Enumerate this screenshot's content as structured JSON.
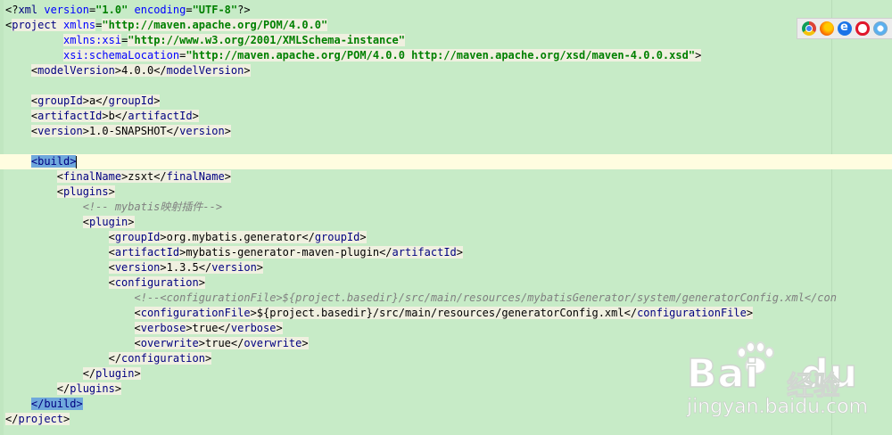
{
  "editor": {
    "lines": [
      {
        "segs": [
          [
            "bracket",
            "<?"
          ],
          [
            "tag",
            "xml "
          ],
          [
            "attr",
            "version"
          ],
          [
            "text",
            "="
          ],
          [
            "str",
            "\"1.0\""
          ],
          [
            "text",
            " "
          ],
          [
            "attr",
            "encoding"
          ],
          [
            "text",
            "="
          ],
          [
            "str",
            "\"UTF-8\""
          ],
          [
            "bracket",
            "?>"
          ]
        ]
      },
      {
        "segs": [
          [
            "bracket",
            "<"
          ],
          [
            "tag",
            "project "
          ],
          [
            "attr",
            "xmlns"
          ],
          [
            "text",
            "="
          ],
          [
            "str",
            "\"http://maven.apache.org/POM/4.0.0\""
          ]
        ]
      },
      {
        "segs": [
          [
            "text",
            "         "
          ],
          [
            "attr",
            "xmlns:xsi"
          ],
          [
            "text",
            "="
          ],
          [
            "str",
            "\"http://www.w3.org/2001/XMLSchema-instance\""
          ]
        ]
      },
      {
        "segs": [
          [
            "text",
            "         "
          ],
          [
            "attr",
            "xsi:schemaLocation"
          ],
          [
            "text",
            "="
          ],
          [
            "str",
            "\"http://maven.apache.org/POM/4.0.0 http://maven.apache.org/xsd/maven-4.0.0.xsd\""
          ],
          [
            "bracket",
            ">"
          ]
        ],
        "box": true
      },
      {
        "segs": [
          [
            "text",
            "    "
          ],
          [
            "bracket",
            "<"
          ],
          [
            "tag",
            "modelVersion"
          ],
          [
            "bracket",
            ">"
          ],
          [
            "text",
            "4.0.0"
          ],
          [
            "bracket",
            "</"
          ],
          [
            "tag",
            "modelVersion"
          ],
          [
            "bracket",
            ">"
          ]
        ]
      },
      {
        "segs": []
      },
      {
        "segs": [
          [
            "text",
            "    "
          ],
          [
            "bracket",
            "<"
          ],
          [
            "tag",
            "groupId"
          ],
          [
            "bracket",
            ">"
          ],
          [
            "text",
            "a"
          ],
          [
            "bracket",
            "</"
          ],
          [
            "tag",
            "groupId"
          ],
          [
            "bracket",
            ">"
          ]
        ]
      },
      {
        "segs": [
          [
            "text",
            "    "
          ],
          [
            "bracket",
            "<"
          ],
          [
            "tag",
            "artifactId"
          ],
          [
            "bracket",
            ">"
          ],
          [
            "text",
            "b"
          ],
          [
            "bracket",
            "</"
          ],
          [
            "tag",
            "artifactId"
          ],
          [
            "bracket",
            ">"
          ]
        ]
      },
      {
        "segs": [
          [
            "text",
            "    "
          ],
          [
            "bracket",
            "<"
          ],
          [
            "tag",
            "version"
          ],
          [
            "bracket",
            ">"
          ],
          [
            "text",
            "1.0-SNAPSHOT"
          ],
          [
            "bracket",
            "</"
          ],
          [
            "tag",
            "version"
          ],
          [
            "bracket",
            ">"
          ]
        ]
      },
      {
        "segs": []
      },
      {
        "segs": [
          [
            "text",
            "    "
          ],
          [
            "hl",
            "<build>"
          ],
          [
            "caret",
            ""
          ]
        ],
        "current": true
      },
      {
        "segs": [
          [
            "text",
            "        "
          ],
          [
            "bracket",
            "<"
          ],
          [
            "tag",
            "finalName"
          ],
          [
            "bracket",
            ">"
          ],
          [
            "text",
            "zsxt"
          ],
          [
            "bracket",
            "</"
          ],
          [
            "tag",
            "finalName"
          ],
          [
            "bracket",
            ">"
          ]
        ]
      },
      {
        "segs": [
          [
            "text",
            "        "
          ],
          [
            "bracket",
            "<"
          ],
          [
            "tag",
            "plugins"
          ],
          [
            "bracket",
            ">"
          ]
        ]
      },
      {
        "segs": [
          [
            "text",
            "            "
          ],
          [
            "comment",
            "<!-- mybatis映射插件-->"
          ]
        ]
      },
      {
        "segs": [
          [
            "text",
            "            "
          ],
          [
            "bracket",
            "<"
          ],
          [
            "tag",
            "plugin"
          ],
          [
            "bracket",
            ">"
          ]
        ]
      },
      {
        "segs": [
          [
            "text",
            "                "
          ],
          [
            "bracket",
            "<"
          ],
          [
            "tag",
            "groupId"
          ],
          [
            "bracket",
            ">"
          ],
          [
            "text",
            "org.mybatis.generator"
          ],
          [
            "bracket",
            "</"
          ],
          [
            "tag",
            "groupId"
          ],
          [
            "bracket",
            ">"
          ]
        ]
      },
      {
        "segs": [
          [
            "text",
            "                "
          ],
          [
            "bracket",
            "<"
          ],
          [
            "tag",
            "artifactId"
          ],
          [
            "bracket",
            ">"
          ],
          [
            "text",
            "mybatis-generator-maven-plugin"
          ],
          [
            "bracket",
            "</"
          ],
          [
            "tag",
            "artifactId"
          ],
          [
            "bracket",
            ">"
          ]
        ]
      },
      {
        "segs": [
          [
            "text",
            "                "
          ],
          [
            "bracket",
            "<"
          ],
          [
            "tag",
            "version"
          ],
          [
            "bracket",
            ">"
          ],
          [
            "text",
            "1.3.5"
          ],
          [
            "bracket",
            "</"
          ],
          [
            "tag",
            "version"
          ],
          [
            "bracket",
            ">"
          ]
        ]
      },
      {
        "segs": [
          [
            "text",
            "                "
          ],
          [
            "bracket",
            "<"
          ],
          [
            "tag",
            "configuration"
          ],
          [
            "bracket",
            ">"
          ]
        ]
      },
      {
        "segs": [
          [
            "text",
            "                    "
          ],
          [
            "comment",
            "<!--<configurationFile>${project.basedir}/src/main/resources/mybatisGenerator/system/generatorConfig.xml</con"
          ]
        ]
      },
      {
        "segs": [
          [
            "text",
            "                    "
          ],
          [
            "bracket",
            "<"
          ],
          [
            "tag",
            "configurationFile"
          ],
          [
            "bracket",
            ">"
          ],
          [
            "text",
            "${project.basedir}/src/main/resources/generatorConfig.xml"
          ],
          [
            "bracket",
            "</"
          ],
          [
            "tag",
            "configurationFile"
          ],
          [
            "bracket",
            ">"
          ]
        ]
      },
      {
        "segs": [
          [
            "text",
            "                    "
          ],
          [
            "bracket",
            "<"
          ],
          [
            "tag",
            "verbose"
          ],
          [
            "bracket",
            ">"
          ],
          [
            "text",
            "true"
          ],
          [
            "bracket",
            "</"
          ],
          [
            "tag",
            "verbose"
          ],
          [
            "bracket",
            ">"
          ]
        ]
      },
      {
        "segs": [
          [
            "text",
            "                    "
          ],
          [
            "bracket",
            "<"
          ],
          [
            "tag",
            "overwrite"
          ],
          [
            "bracket",
            ">"
          ],
          [
            "text",
            "true"
          ],
          [
            "bracket",
            "</"
          ],
          [
            "tag",
            "overwrite"
          ],
          [
            "bracket",
            ">"
          ]
        ]
      },
      {
        "segs": [
          [
            "text",
            "                "
          ],
          [
            "bracket",
            "</"
          ],
          [
            "tag",
            "configuration"
          ],
          [
            "bracket",
            ">"
          ]
        ]
      },
      {
        "segs": [
          [
            "text",
            "            "
          ],
          [
            "bracket",
            "</"
          ],
          [
            "tag",
            "plugin"
          ],
          [
            "bracket",
            ">"
          ]
        ]
      },
      {
        "segs": [
          [
            "text",
            "        "
          ],
          [
            "bracket",
            "</"
          ],
          [
            "tag",
            "plugins"
          ],
          [
            "bracket",
            ">"
          ]
        ]
      },
      {
        "segs": [
          [
            "text",
            "    "
          ],
          [
            "hl",
            "</build>"
          ]
        ]
      },
      {
        "segs": [
          [
            "bracket",
            "</"
          ],
          [
            "tag",
            "project"
          ],
          [
            "bracket",
            ">"
          ]
        ]
      }
    ]
  },
  "browser_icons": [
    "chrome-icon",
    "firefox-icon",
    "ie-icon",
    "opera-icon",
    "safari-icon"
  ],
  "watermark": {
    "brand": "Bai",
    "brand_tail": "du",
    "cn": "经验",
    "url": "jingyan.baidu.com"
  },
  "colors": {
    "background": "#c7ebc7",
    "tag": "#000080",
    "attribute": "#0000ff",
    "string": "#008000",
    "comment": "#808080",
    "current_line": "#fffde0",
    "match_highlight": "#6fa8dc"
  }
}
